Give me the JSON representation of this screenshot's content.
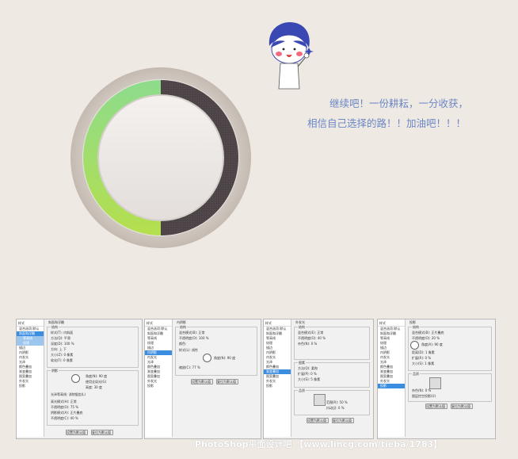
{
  "quote": {
    "line1": "继续吧！一份耕耘，一分收获，",
    "line2": "相信自己选择的路！！加油吧！！！"
  },
  "watermark": "PhotoShop平面设计吧 【www.lincg.com/tieba/1783】",
  "colors": {
    "background": "#efe9e4",
    "ring_outer": "#cfc6bf",
    "progress_green_top": "#8ddc8c",
    "progress_green_bottom": "#b5df4d",
    "track_dark": "#4c4446",
    "quote_text": "#6a87c4"
  },
  "progress_ring": {
    "fraction_green": 0.5
  },
  "layer_style_panels": [
    {
      "sidebar_title": "样式",
      "sidebar_items": [
        "混合选项:默认",
        "斜面和浮雕",
        "等高线",
        "纹理",
        "描边",
        "内阴影",
        "内发光",
        "光泽",
        "颜色叠加",
        "渐变叠加",
        "图案叠加",
        "外发光",
        "投影"
      ],
      "selected": 1,
      "section": "斜面和浮雕",
      "sub1": "结构",
      "sub2": "阴影",
      "rows": [
        "样式(T): 内斜面",
        "方法(Q): 平滑",
        "深度(D): 100 %",
        "方向: 上 下",
        "大小(Z): 0 像素",
        "软化(F): 0 像素"
      ],
      "rows2": [
        "角度(N): 90 度",
        "使用全局光(G)",
        "高度: 30 度",
        "光泽等高线: 消除锯齿(L)",
        "高光模式(H): 正常",
        "不透明度(O): 75 %",
        "阴影模式(A): 正片叠底",
        "不透明度(C): 40 %"
      ],
      "btn1": "设置为默认值",
      "btn2": "复位为默认值"
    },
    {
      "sidebar_title": "样式",
      "sidebar_items": [
        "混合选项:默认",
        "斜面和浮雕",
        "等高线",
        "纹理",
        "描边",
        "内阴影",
        "内发光",
        "光泽",
        "颜色叠加",
        "渐变叠加",
        "图案叠加",
        "外发光",
        "投影"
      ],
      "selected": 5,
      "section": "内阴影",
      "sub1": "结构",
      "rows": [
        "混合模式(B): 正常",
        "不透明度(O): 100 %",
        "颜色: ",
        "样式(L): 线性",
        "角度(N): 90 度",
        "缩放(C): 77 %"
      ],
      "btn1": "设置为默认值",
      "btn2": "复位为默认值"
    },
    {
      "sidebar_title": "样式",
      "sidebar_items": [
        "混合选项:默认",
        "斜面和浮雕",
        "等高线",
        "纹理",
        "描边",
        "内阴影",
        "内发光",
        "光泽",
        "颜色叠加",
        "渐变叠加",
        "图案叠加",
        "外发光",
        "投影"
      ],
      "selected": 9,
      "section": "外发光",
      "sub1": "结构",
      "sub2": "图素",
      "sub3": "品质",
      "rows": [
        "混合模式(E): 正常",
        "不透明度(O): 40 %",
        "杂色(N): 0 %",
        "方法(Q): 柔和",
        "扩展(P): 0 %",
        "大小(S): 5 像素",
        "范围(R): 50 %",
        "抖动(J): 0 %"
      ],
      "btn1": "设置为默认值",
      "btn2": "复位为默认值"
    },
    {
      "sidebar_title": "样式",
      "sidebar_items": [
        "混合选项:默认",
        "斜面和浮雕",
        "等高线",
        "纹理",
        "描边",
        "内阴影",
        "内发光",
        "光泽",
        "颜色叠加",
        "渐变叠加",
        "图案叠加",
        "外发光",
        "投影"
      ],
      "selected": 12,
      "section": "投影",
      "sub1": "结构",
      "sub2": "品质",
      "rows": [
        "混合模式(B): 正片叠底",
        "不透明度(O): 20 %",
        "角度(A): 90 度",
        "距离(D): 1 像素",
        "扩展(R): 0 %",
        "大小(S): 1 像素",
        "杂色(N): 0 %",
        "图层挖空投影(U)"
      ],
      "btn1": "设置为默认值",
      "btn2": "复位为默认值"
    }
  ]
}
